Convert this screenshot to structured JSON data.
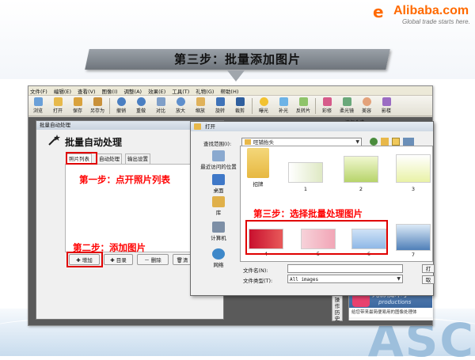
{
  "logo": {
    "mark": "e",
    "name": "Alibaba.com",
    "tagline": "Global trade starts here."
  },
  "banner": {
    "text": "第三步：批量添加图片"
  },
  "app": {
    "menu": [
      "文件(F)",
      "编辑(E)",
      "查看(V)",
      "图像(I)",
      "调整(A)",
      "效果(E)",
      "工具(T)",
      "礼物(G)",
      "帮助(H)"
    ],
    "toolbar": [
      "浏览",
      "打开",
      "保存",
      "另存为",
      "撤销",
      "重做",
      "对比",
      "放大",
      "缩放",
      "旋转",
      "裁剪",
      "曝光",
      "补光",
      "反转片",
      "彩修",
      "柔光镜",
      "美容",
      "影楼"
    ],
    "side_label": "边框合成"
  },
  "batch": {
    "window_title": "批量自动处理",
    "heading": "批量自动处理",
    "tabs": [
      "照片列表",
      "自动处理",
      "输出设置"
    ],
    "buttons": {
      "add": "增加",
      "dir": "目录",
      "delete": "删除",
      "clear": "清"
    }
  },
  "callouts": {
    "step1": "第一步：点开照片列表",
    "step2": "第二步：添加图片",
    "step3": "第三步：选择批量处理图片"
  },
  "open_dialog": {
    "title": "打开",
    "look_in_label": "查找范围(I):",
    "look_in_value": "旺铺抬头",
    "places": [
      "最近访问的位置",
      "桌面",
      "库",
      "计算机",
      "网络"
    ],
    "items": [
      {
        "label": "招牌",
        "kind": "folder"
      },
      {
        "label": "1"
      },
      {
        "label": "2"
      },
      {
        "label": "3"
      },
      {
        "label": "4"
      },
      {
        "label": "5"
      },
      {
        "label": "6"
      },
      {
        "label": "7"
      }
    ],
    "filename_label": "文件名(N):",
    "filename_value": "",
    "filetype_label": "文件类型(T):",
    "filetype_value": "All images",
    "open_button": "打",
    "cancel_button": "取"
  },
  "bg_panel": {
    "history_tab": "操作历史",
    "promo_title": "光影魔术手",
    "promo_sub": "productions",
    "promo_foot": "给您带来最简便易用的图像处理体"
  },
  "watermark": "ASC"
}
